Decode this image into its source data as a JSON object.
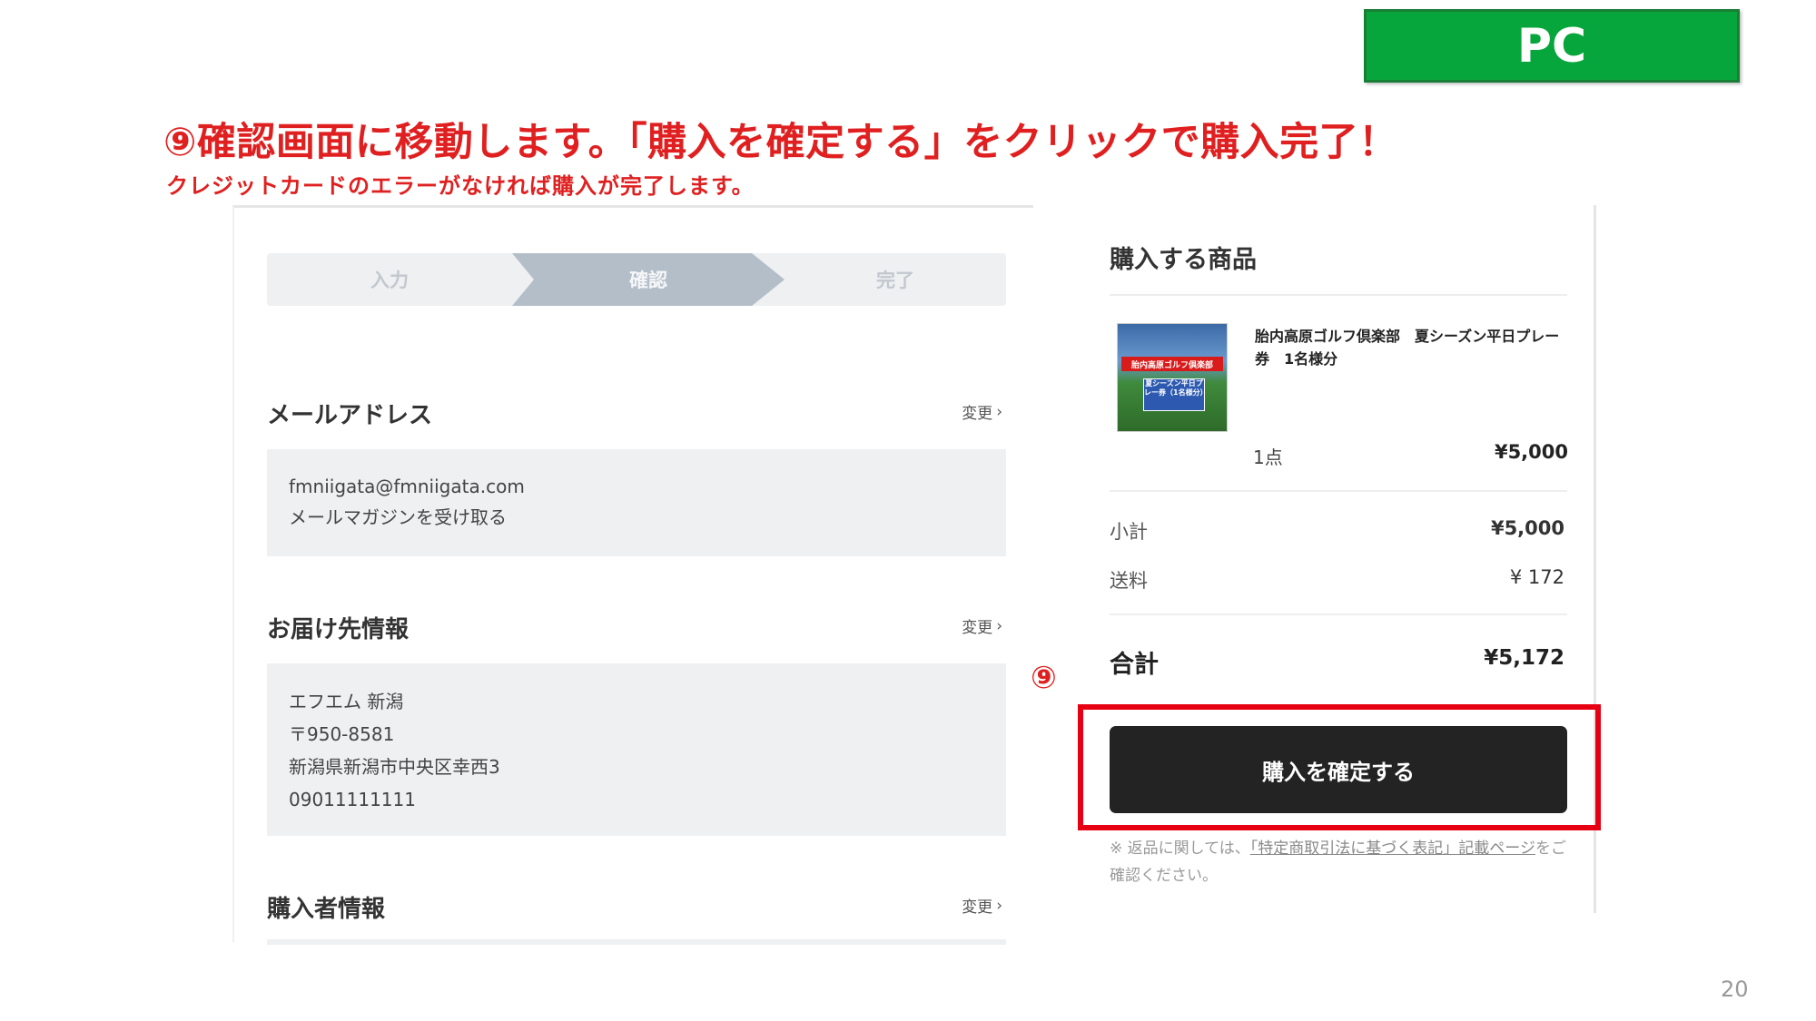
{
  "badge": "PC",
  "heading": "⑨確認画面に移動します。「購入を確定する」をクリックで購入完了！",
  "subheading": "クレジットカードのエラーがなければ購入が完了します。",
  "page_number": "20",
  "steps": [
    "入力",
    "確認",
    "完了"
  ],
  "active_step": "確認",
  "change_label": "変更",
  "email_section": {
    "title": "メールアドレス",
    "lines": [
      "fmniigata@fmniigata.com",
      "メールマガジンを受け取る"
    ]
  },
  "delivery_section": {
    "title": "お届け先情報",
    "lines": [
      "エフエム 新潟",
      "〒950-8581",
      "新潟県新潟市中央区幸西3",
      "09011111111"
    ]
  },
  "purchaser_section": {
    "title": "購入者情報"
  },
  "order": {
    "title": "購入する商品",
    "product_name": "胎内高原ゴルフ倶楽部　夏シーズン平日プレー券　1名様分",
    "thumb_banner": "胎内高原ゴルフ倶楽部",
    "thumb_sub": "夏シーズン平日プレー券（1名様分）",
    "quantity": "1点",
    "price": "¥5,000",
    "subtotal_label": "小計",
    "subtotal": "¥5,000",
    "shipping_label": "送料",
    "shipping": "¥ 172",
    "total_label": "合計",
    "total": "¥5,172",
    "confirm_button": "購入を確定する",
    "note_prefix": "※ 返品に関しては、",
    "note_link": "「特定商取引法に基づく表記」記載ページ",
    "note_suffix": "をご確認ください。"
  },
  "marker": "⑨",
  "colors": {
    "accent_red": "#e60012",
    "badge_green": "#07a63c",
    "button_dark": "#232323"
  }
}
